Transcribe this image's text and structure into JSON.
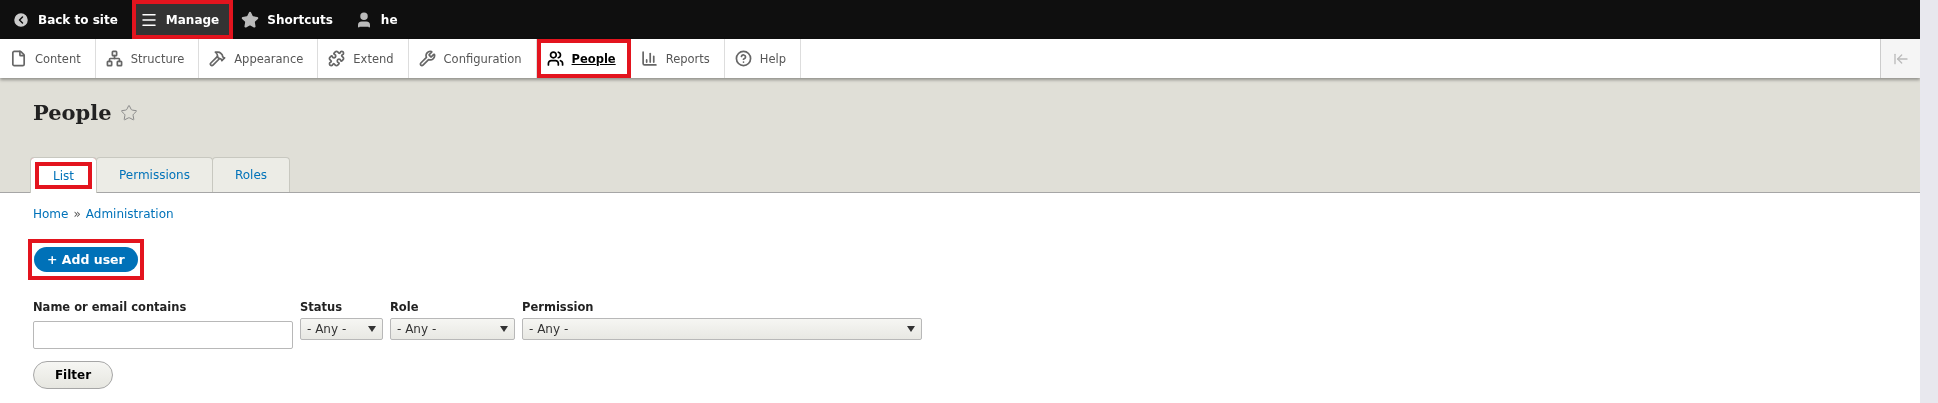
{
  "toolbar": {
    "items": [
      {
        "kind": "back",
        "label": "Back to site",
        "selected": false,
        "highlighted": false
      },
      {
        "kind": "menu",
        "label": "Manage",
        "selected": true,
        "highlighted": true
      },
      {
        "kind": "star",
        "label": "Shortcuts",
        "selected": false,
        "highlighted": false
      },
      {
        "kind": "user",
        "label": "he",
        "selected": false,
        "highlighted": false
      }
    ]
  },
  "tray": {
    "items": [
      {
        "kind": "file",
        "label": "Content",
        "selected": false,
        "highlighted": false
      },
      {
        "kind": "structure",
        "label": "Structure",
        "selected": false,
        "highlighted": false
      },
      {
        "kind": "hammer",
        "label": "Appearance",
        "selected": false,
        "highlighted": false
      },
      {
        "kind": "puzzle",
        "label": "Extend",
        "selected": false,
        "highlighted": false
      },
      {
        "kind": "wrench",
        "label": "Configuration",
        "selected": false,
        "highlighted": false
      },
      {
        "kind": "people",
        "label": "People",
        "selected": true,
        "highlighted": true
      },
      {
        "kind": "chart",
        "label": "Reports",
        "selected": false,
        "highlighted": false
      },
      {
        "kind": "help",
        "label": "Help",
        "selected": false,
        "highlighted": false
      }
    ]
  },
  "page": {
    "title": "People",
    "tabs": [
      {
        "label": "List",
        "selected": true,
        "highlighted": true
      },
      {
        "label": "Permissions",
        "selected": false,
        "highlighted": false
      },
      {
        "label": "Roles",
        "selected": false,
        "highlighted": false
      }
    ]
  },
  "breadcrumb": [
    "Home",
    "Administration"
  ],
  "breadcrumb_separator": "»",
  "add_button": {
    "label": "+ Add user",
    "highlighted": true
  },
  "filters": [
    {
      "kind": "text",
      "label": "Name or email contains"
    },
    {
      "kind": "select",
      "label": "Status",
      "value": "- Any -"
    },
    {
      "kind": "select",
      "label": "Role",
      "value": "- Any -"
    },
    {
      "kind": "select",
      "label": "Permission",
      "value": "- Any -"
    }
  ],
  "filter_button": "Filter"
}
